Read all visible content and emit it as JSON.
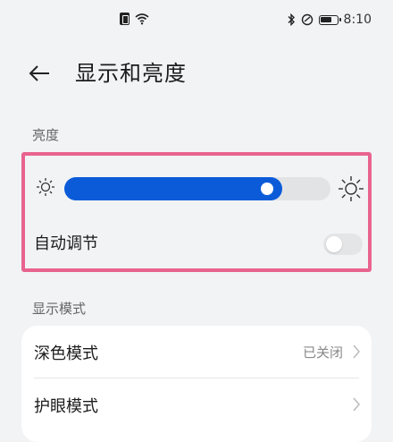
{
  "status_bar": {
    "time": "8:10",
    "icons": [
      "sim-icon",
      "wifi-icon",
      "bluetooth-icon",
      "dnd-icon",
      "battery-icon"
    ]
  },
  "header": {
    "back_icon": "arrow-left-icon",
    "title": "显示和亮度"
  },
  "brightness": {
    "section_label": "亮度",
    "slider_level_percent": 82,
    "min_icon": "sun-small-icon",
    "max_icon": "sun-large-icon",
    "auto_adjust_label": "自动调节",
    "auto_adjust_on": false,
    "accent_color": "#0b5bd9",
    "highlight_color": "#e8648f"
  },
  "display_mode": {
    "section_label": "显示模式",
    "items": [
      {
        "label": "深色模式",
        "value": "已关闭"
      },
      {
        "label": "护眼模式",
        "value": ""
      }
    ]
  }
}
